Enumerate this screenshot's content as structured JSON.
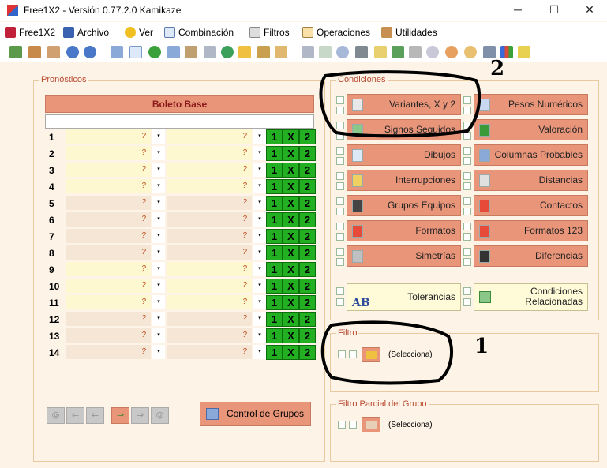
{
  "window": {
    "title": "Free1X2 - Versión 0.77.2.0 Kamikaze",
    "minimize": "─",
    "maximize": "☐",
    "close": "✕"
  },
  "menu": [
    {
      "label": "Free1X2",
      "icon": "app-logo-icon"
    },
    {
      "label": "Archivo",
      "icon": "save-icon"
    },
    {
      "label": "Ver",
      "icon": "lightbulb-icon"
    },
    {
      "label": "Combinación",
      "icon": "document-icon"
    },
    {
      "label": "Filtros",
      "icon": "funnel-icon"
    },
    {
      "label": "Operaciones",
      "icon": "calculator-icon"
    },
    {
      "label": "Utilidades",
      "icon": "wrench-icon"
    }
  ],
  "pronosticos": {
    "label": "Pronósticos",
    "header": "Boleto Base",
    "rows": [
      "1",
      "2",
      "3",
      "4",
      "5",
      "6",
      "7",
      "8",
      "9",
      "10",
      "11",
      "12",
      "13",
      "14"
    ],
    "q": "?",
    "arrow": "▾",
    "opts": [
      "1",
      "X",
      "2"
    ]
  },
  "condiciones": {
    "label": "Condiciones",
    "buttons": [
      "Variantes, X y 2",
      "Pesos Numéricos",
      "Signos Seguidos",
      "Valoración",
      "Dibujos",
      "Columnas Probables",
      "Interrupciones",
      "Distancias",
      "Grupos Equipos",
      "Contactos",
      "Formatos",
      "Formatos 123",
      "Simetrías",
      "Diferencias"
    ],
    "tolerancias": "Tolerancias",
    "relacionadas": "Condiciones Relacionadas"
  },
  "filtro": {
    "label": "Filtro",
    "value": "(Selecciona)"
  },
  "filtro_parcial": {
    "label": "Filtro Parcial del Grupo",
    "value": "(Selecciona)"
  },
  "control_grupos": "Control de Grupos",
  "annotations": {
    "one": "1",
    "two": "2"
  },
  "nav": [
    "◎",
    "⇐",
    "⇐",
    "⇒",
    "⇒",
    "◎"
  ]
}
